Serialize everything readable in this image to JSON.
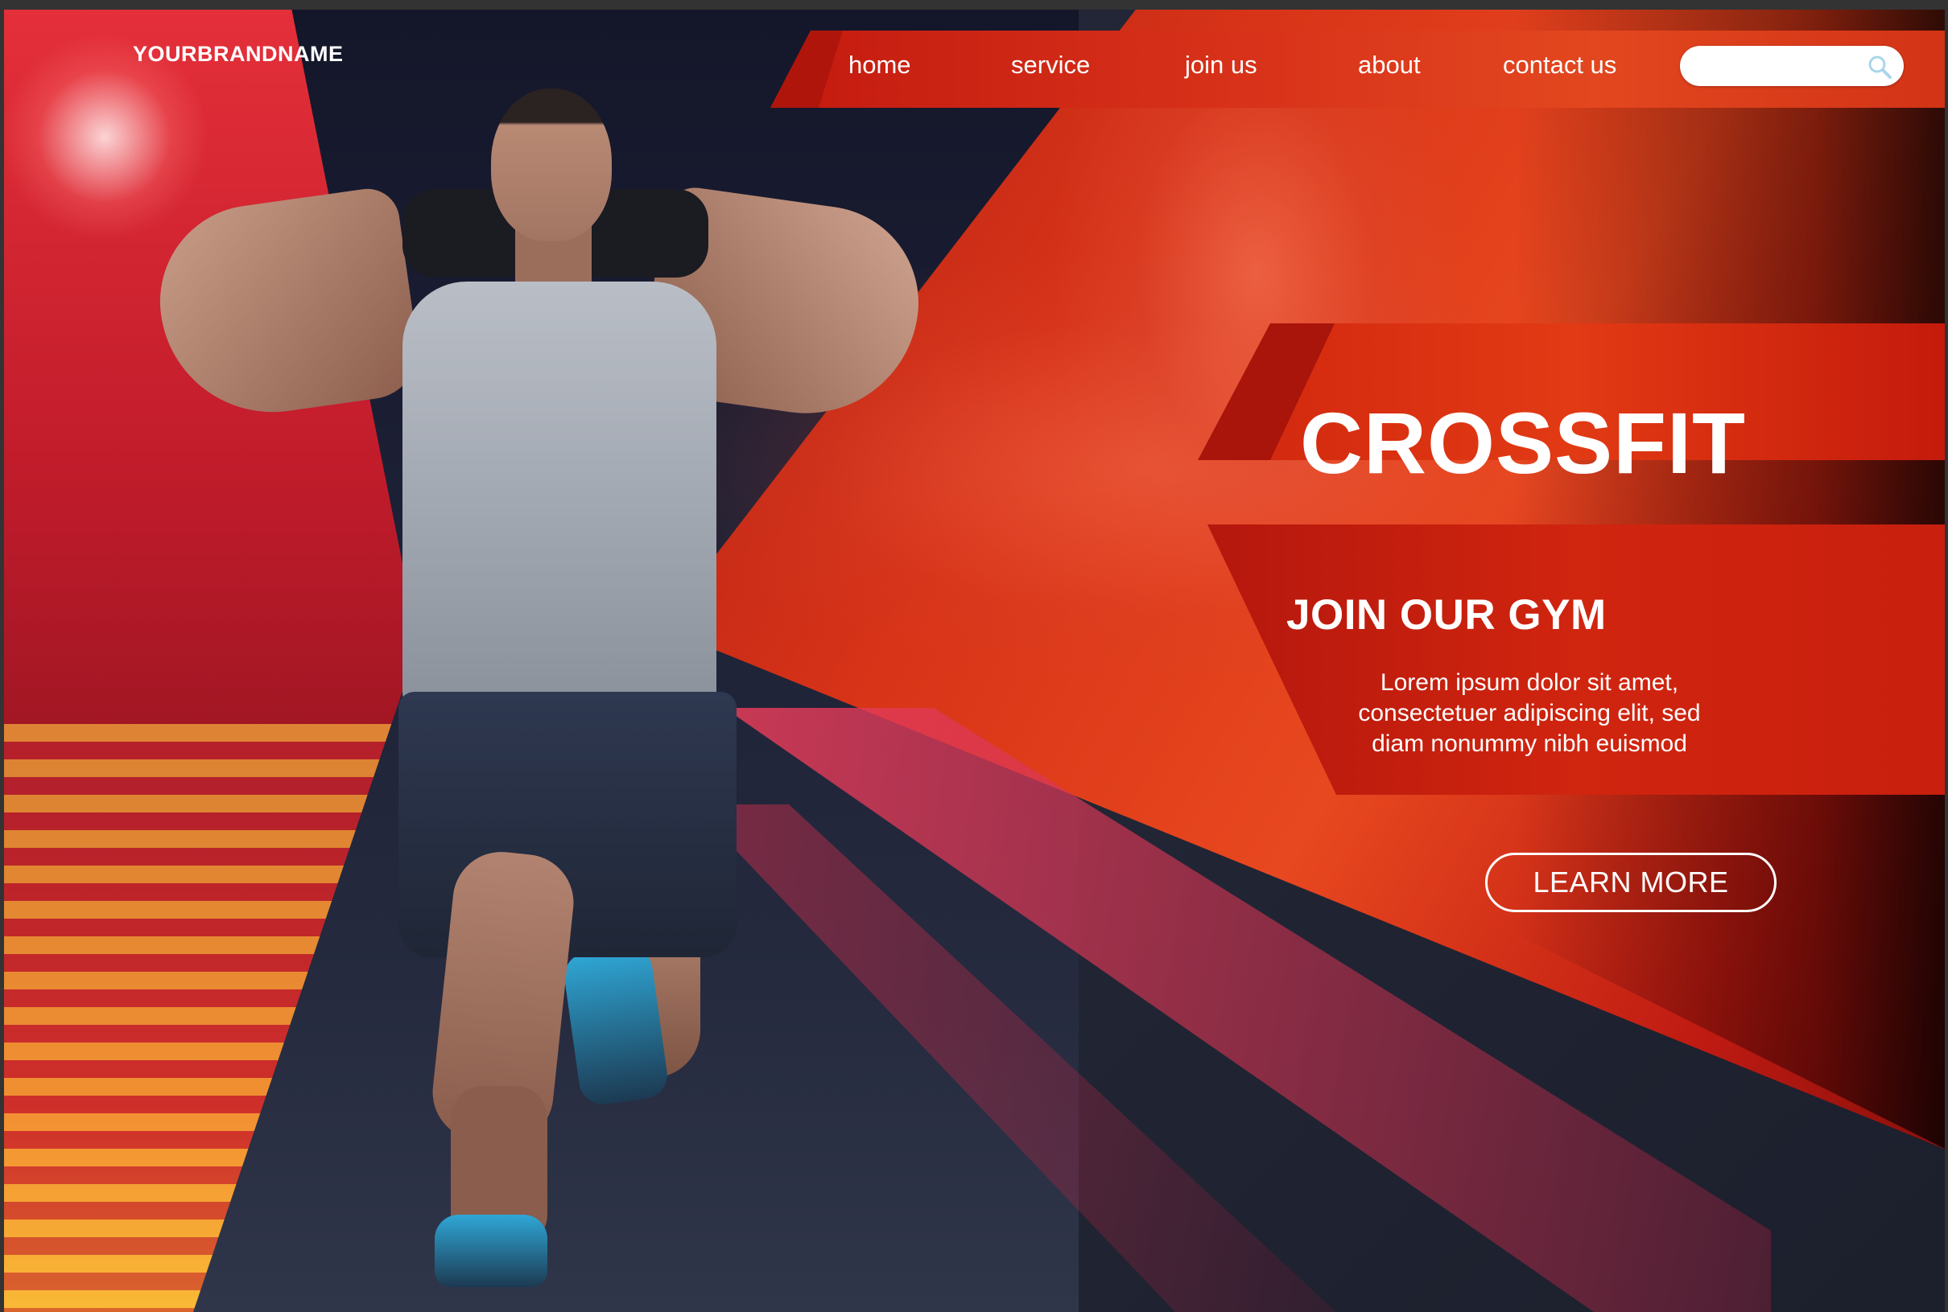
{
  "brand": {
    "name": "YOURBRANDNAME"
  },
  "nav": {
    "items": [
      {
        "label": "home"
      },
      {
        "label": "service"
      },
      {
        "label": "join us"
      },
      {
        "label": "about"
      },
      {
        "label": "contact us"
      }
    ],
    "search": {
      "placeholder": "",
      "icon": "search-icon"
    }
  },
  "hero": {
    "title": "CROSSFIT",
    "subtitle": "JOIN OUR GYM",
    "body_lines": [
      "Lorem ipsum dolor sit amet,",
      "consectetuer adipiscing elit, sed",
      "diam nonummy nibh euismod"
    ],
    "cta_label": "LEARN MORE"
  },
  "colors": {
    "accent_red": "#d8321a",
    "dark_navy": "#1e2236",
    "text": "#ffffff"
  }
}
